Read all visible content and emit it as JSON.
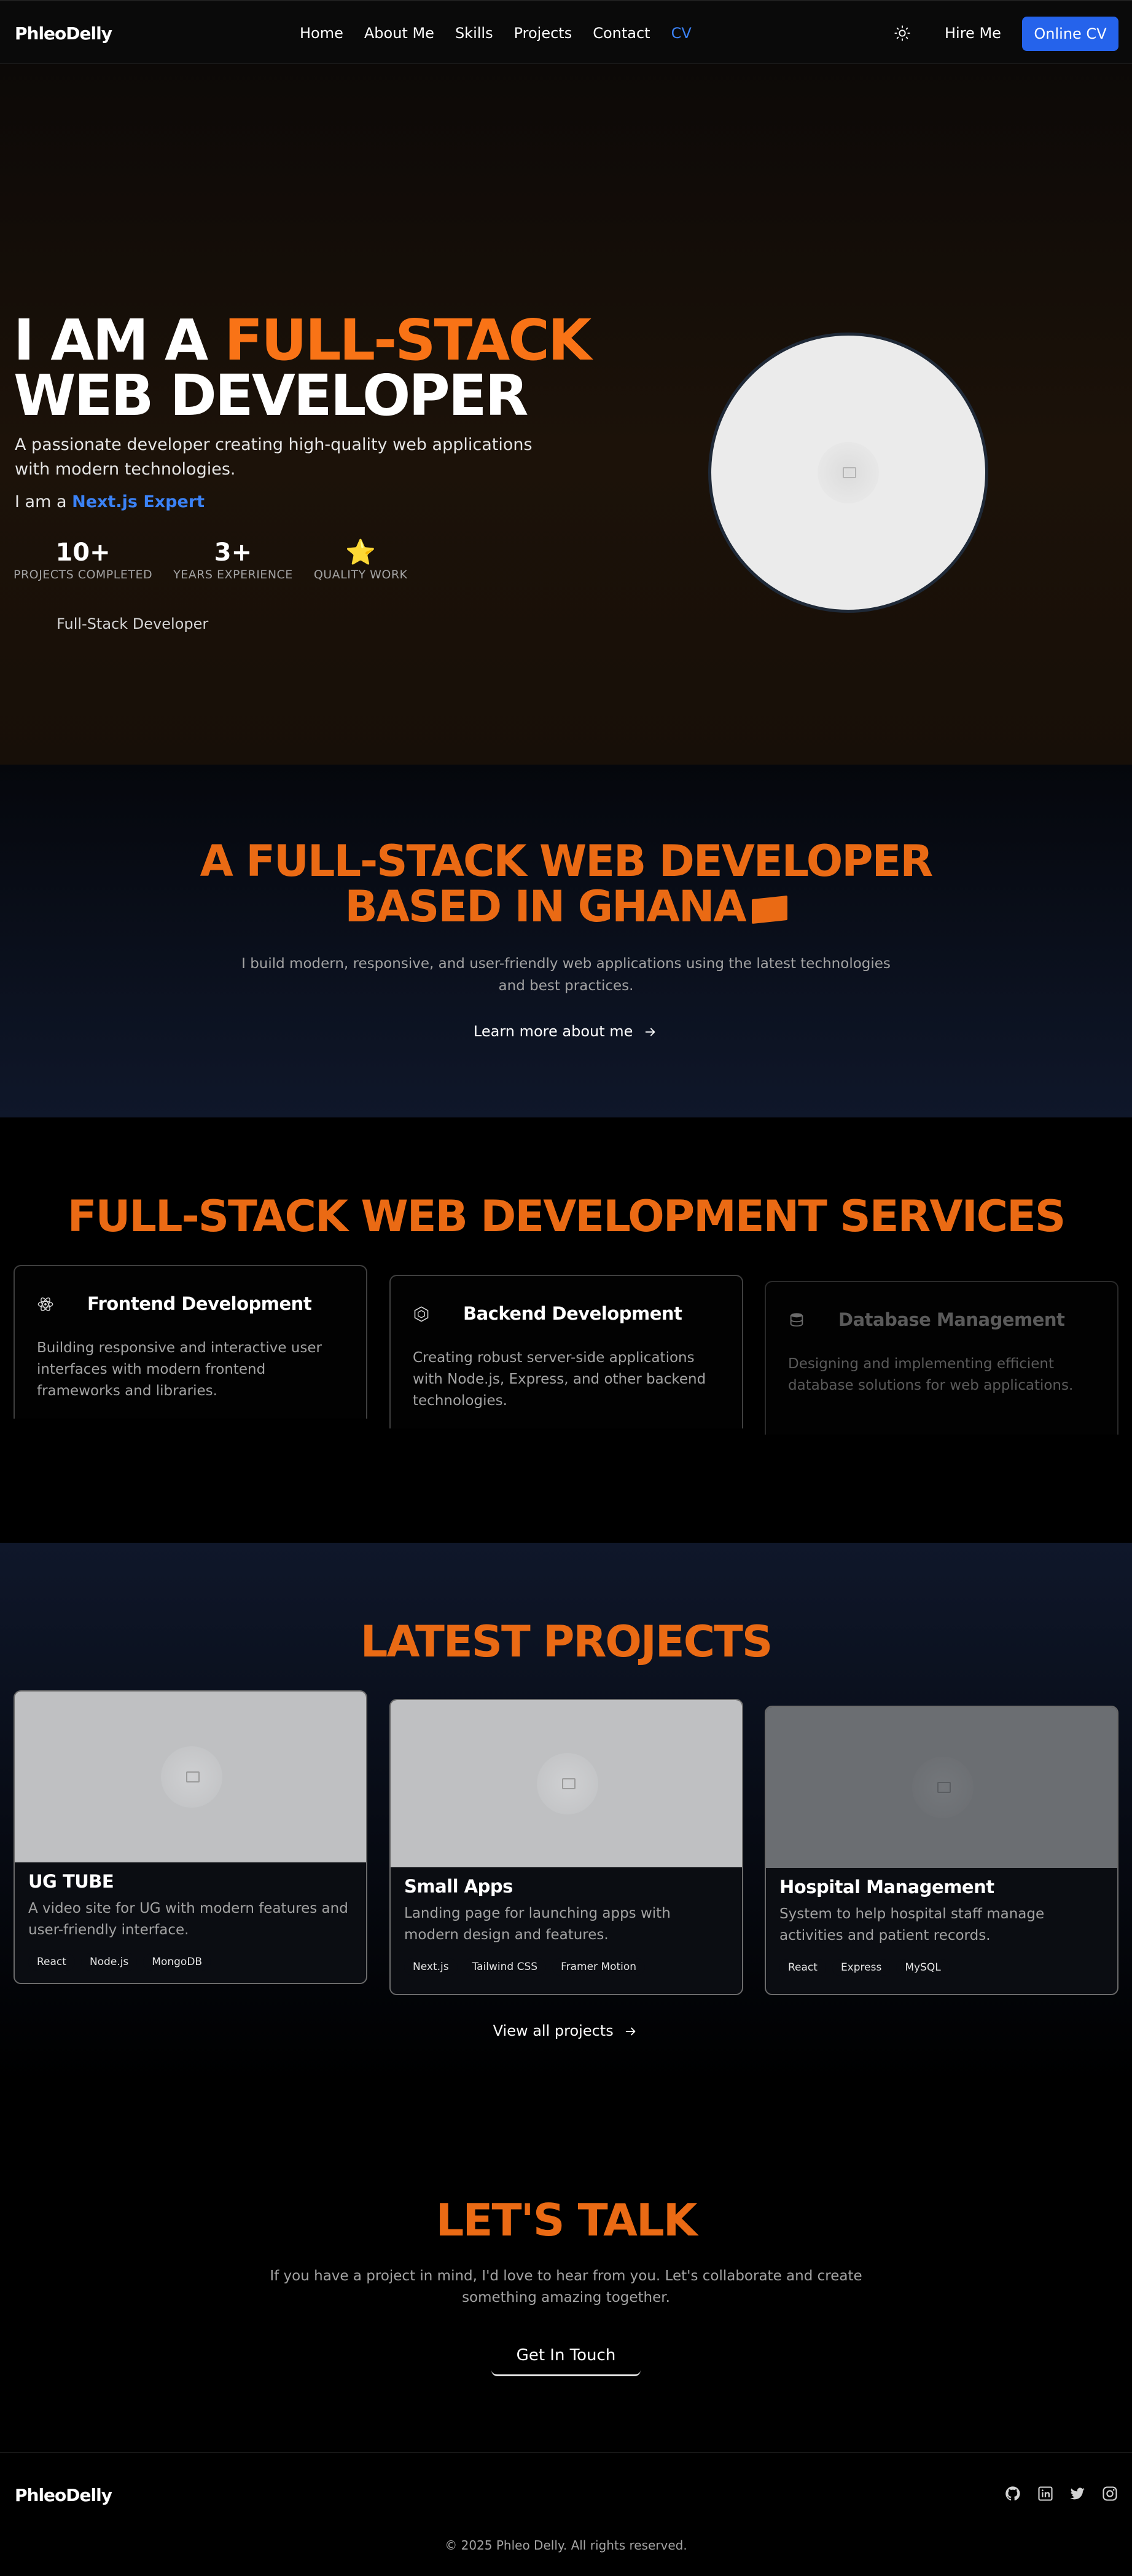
{
  "nav": {
    "logo": "PhleoDelly",
    "links": [
      "Home",
      "About Me",
      "Skills",
      "Projects",
      "Contact",
      "CV"
    ],
    "theme_icon": "sun-icon",
    "hire_label": "Hire Me",
    "online_cv_label": "Online CV"
  },
  "hero": {
    "title_part1": "I AM A ",
    "title_highlight": "FULL-STACK",
    "title_part2": " WEB DEVELOPER",
    "subtitle": "A passionate developer creating high-quality web applications with modern technologies.",
    "iam_prefix": "I am a ",
    "iam_role": "Next.js Expert",
    "stats": [
      {
        "value": "10+",
        "label": "PROJECTS COMPLETED"
      },
      {
        "value": "3+",
        "label": "YEARS EXPERIENCE"
      },
      {
        "value": "⭐",
        "label": "QUALITY WORK"
      }
    ],
    "role_caption": "Full-Stack Developer",
    "avatar_icon": "image-placeholder-icon"
  },
  "about": {
    "title_line1": "A FULL-STACK WEB DEVELOPER",
    "title_line2": "BASED IN GHANA",
    "description": "I build modern, responsive, and user-friendly web applications using the latest technologies and best practices.",
    "link_label": "Learn more about me"
  },
  "services": {
    "title": "FULL-STACK WEB DEVELOPMENT SERVICES",
    "items": [
      {
        "title": "Frontend Development",
        "description": "Building responsive and interactive user interfaces with modern frontend frameworks and libraries.",
        "icon": "react-icon"
      },
      {
        "title": "Backend Development",
        "description": "Creating robust server-side applications with Node.js, Express, and other backend technologies.",
        "icon": "nodejs-icon"
      },
      {
        "title": "Database Management",
        "description": "Designing and implementing efficient database solutions for web applications.",
        "icon": "database-icon"
      }
    ]
  },
  "projects": {
    "title": "LATEST PROJECTS",
    "items": [
      {
        "title": "UG TUBE",
        "description": "A video site for UG with modern features and user-friendly interface.",
        "tags": [
          "React",
          "Node.js",
          "MongoDB"
        ]
      },
      {
        "title": "Small Apps",
        "description": "Landing page for launching apps with modern design and features.",
        "tags": [
          "Next.js",
          "Tailwind CSS",
          "Framer Motion"
        ]
      },
      {
        "title": "Hospital Management",
        "description": "System to help hospital staff manage activities and patient records.",
        "tags": [
          "React",
          "Express",
          "MySQL"
        ]
      }
    ],
    "view_all_label": "View all projects"
  },
  "contact": {
    "title": "LET'S TALK",
    "description": "If you have a project in mind, I'd love to hear from you. Let's collaborate and create something amazing together.",
    "button_label": "Get In Touch"
  },
  "footer": {
    "logo": "PhleoDelly",
    "copyright": "© 2025 Phleo Delly. All rights reserved.",
    "social_icons": [
      "github-icon",
      "linkedin-icon",
      "twitter-icon",
      "instagram-icon"
    ]
  },
  "colors": {
    "accent_orange": "#ea6a14",
    "highlight_orange": "#f97316",
    "primary_blue": "#2563eb",
    "link_blue": "#3b82f6"
  }
}
